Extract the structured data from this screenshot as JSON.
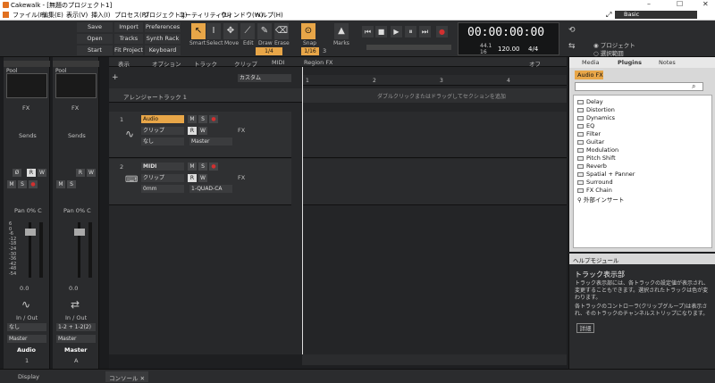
{
  "window": {
    "title": "Cakewalk - [無題のプロジェクト1]",
    "minimize": "–",
    "maximize": "☐",
    "close": "✕"
  },
  "menu": [
    "ファイル(F)",
    "編集(E)",
    "表示(V)",
    "挿入(I)",
    "プロセス(R)",
    "プロジェクト(J)",
    "ユーティリティ(U)",
    "ウィンドウ(W)",
    "ヘルプ(H)"
  ],
  "workspace": {
    "value": "Basic"
  },
  "toolbar": {
    "buttons": [
      "Save",
      "Import",
      "Preferences",
      "Open",
      "Tracks",
      "Synth Rack",
      "Start Screen",
      "Fit Project",
      "Keyboard"
    ],
    "tools": [
      "Smart",
      "Select",
      "Move",
      "Edit",
      "Draw",
      "Erase"
    ],
    "snap_label": "Snap",
    "marks_label": "Marks",
    "snap_value": "1/4",
    "snap_value2": "1/16",
    "snap_num": "3",
    "time": "00:00:00:00",
    "tempo": "120.00",
    "meter": "4/4",
    "beats1": "44.1",
    "beats2": "16",
    "project_opt": "プロジェクト",
    "select_opt": "選択範囲"
  },
  "view_tabs": [
    "表示",
    "オプション",
    "トラック",
    "クリップ",
    "MIDI",
    "Region FX"
  ],
  "view_off": "オフ",
  "arranger": {
    "label": "アレンジャートラック 1",
    "hint": "ダブルクリックまたはドラッグしてセクションを追加",
    "custom": "カスタム"
  },
  "ruler": [
    "1",
    "2",
    "3",
    "4"
  ],
  "tracks": [
    {
      "num": "1",
      "name": "Audio",
      "clip": "クリップ",
      "input": "なし",
      "output": "Master",
      "fx": "FX"
    },
    {
      "num": "2",
      "name": "MIDI",
      "clip": "クリップ",
      "input": "0mm",
      "output": "1-QUAD-CA",
      "fx": "FX"
    }
  ],
  "strips": [
    {
      "name": "Audio",
      "num": "1",
      "fx": "FX",
      "sends": "Sends",
      "pan": "Pan 0% C",
      "level": "0.0",
      "io": "In / Out",
      "in": "なし",
      "out": "Master"
    },
    {
      "name": "Master",
      "num": "A",
      "fx": "FX",
      "sends": "Sends",
      "pan": "Pan 0% C",
      "level": "0.0",
      "io": "In / Out",
      "in": "1-2 + 1-2(2)",
      "out": "Master"
    }
  ],
  "strip_btns": {
    "m": "M",
    "s": "S",
    "r": "R",
    "w": "W",
    "phase": "Ø",
    "rec": "●",
    "mono": "⊙"
  },
  "fader_scale": [
    "6",
    "0",
    "-6",
    "-12",
    "-18",
    "-24",
    "-30",
    "-36",
    "-42",
    "-48",
    "-54"
  ],
  "bottom": {
    "display": "Display",
    "console": "コンソール"
  },
  "browser": {
    "tabs": [
      "Media",
      "Plugins",
      "Notes"
    ],
    "audio_fx": "Audio FX",
    "items": [
      "Delay",
      "Distortion",
      "Dynamics",
      "EQ",
      "Filter",
      "Guitar",
      "Modulation",
      "Pitch Shift",
      "Reverb",
      "Spatial + Panner",
      "Surround",
      "FX Chain",
      "外部インサート"
    ]
  },
  "help": {
    "header": "ヘルプモジュール",
    "title": "トラック表示部",
    "p1": "トラック表示部には、各トラックの設定値が表示され、変更することもできます。選択されたトラックは色が変わります。",
    "p2": "各トラックのコントローラ(クリップグループ)は表示され、そのトラックのチャンネルストリップになります。",
    "detail": "詳細"
  },
  "colors": {
    "accent": "#e8a648",
    "record": "#d23030",
    "bg": "#1e1f21"
  }
}
